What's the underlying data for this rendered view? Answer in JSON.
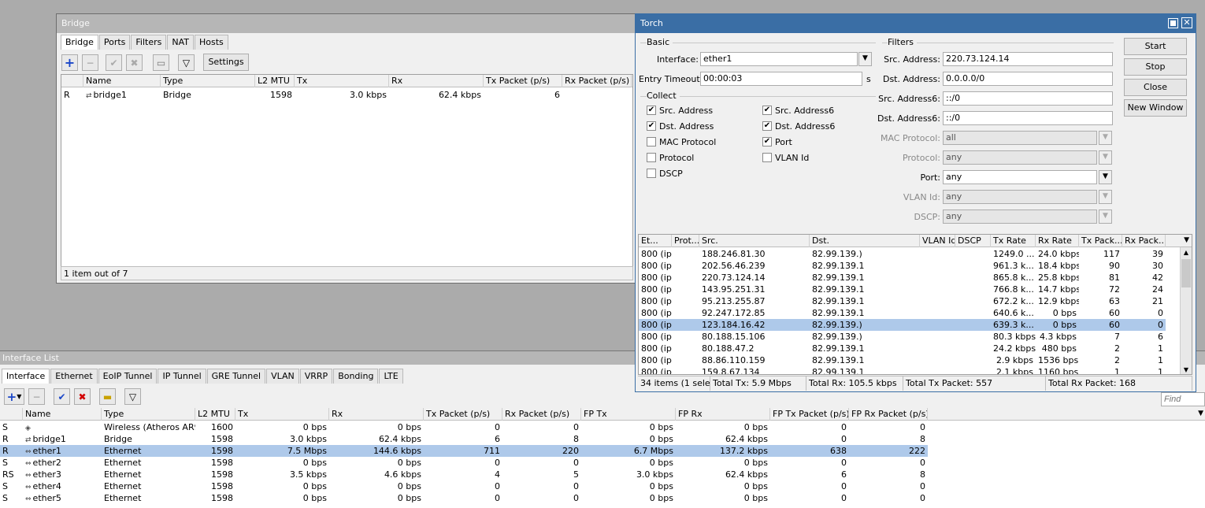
{
  "bridge": {
    "title": "Bridge",
    "tabs": [
      "Bridge",
      "Ports",
      "Filters",
      "NAT",
      "Hosts"
    ],
    "settings_label": "Settings",
    "columns": [
      "",
      "Name",
      "Type",
      "L2 MTU",
      "Tx",
      "Rx",
      "Tx Packet (p/s)",
      "Rx Packet (p/s)"
    ],
    "rows": [
      [
        "R",
        "bridge1",
        "Bridge",
        "1598",
        "3.0 kbps",
        "62.4 kbps",
        "6",
        ""
      ]
    ],
    "status": "1 item out of 7"
  },
  "torch": {
    "title": "Torch",
    "basic_label": "Basic",
    "interface_label": "Interface:",
    "interface_value": "ether1",
    "entry_timeout_label": "Entry Timeout:",
    "entry_timeout_value": "00:00:03",
    "entry_timeout_unit": "s",
    "collect_label": "Collect",
    "collect": [
      {
        "label": "Src. Address",
        "checked": true
      },
      {
        "label": "Dst. Address",
        "checked": true
      },
      {
        "label": "MAC Protocol",
        "checked": false
      },
      {
        "label": "Protocol",
        "checked": false
      },
      {
        "label": "DSCP",
        "checked": false
      },
      {
        "label": "Src. Address6",
        "checked": true
      },
      {
        "label": "Dst. Address6",
        "checked": true
      },
      {
        "label": "Port",
        "checked": true
      },
      {
        "label": "VLAN Id",
        "checked": false
      }
    ],
    "filters_label": "Filters",
    "filters": [
      {
        "label": "Src. Address:",
        "value": "220.73.124.14",
        "disabled": false,
        "dd": false
      },
      {
        "label": "Dst. Address:",
        "value": "0.0.0.0/0",
        "disabled": false,
        "dd": false
      },
      {
        "label": "Src. Address6:",
        "value": "::/0",
        "disabled": false,
        "dd": false
      },
      {
        "label": "Dst. Address6:",
        "value": "::/0",
        "disabled": false,
        "dd": false
      },
      {
        "label": "MAC Protocol:",
        "value": "all",
        "disabled": true,
        "dd": true
      },
      {
        "label": "Protocol:",
        "value": "any",
        "disabled": true,
        "dd": true
      },
      {
        "label": "Port:",
        "value": "any",
        "disabled": false,
        "dd": true
      },
      {
        "label": "VLAN Id:",
        "value": "any",
        "disabled": true,
        "dd": true
      },
      {
        "label": "DSCP:",
        "value": "any",
        "disabled": true,
        "dd": true
      }
    ],
    "buttons": [
      "Start",
      "Stop",
      "Close",
      "New Window"
    ],
    "columns": [
      "Et...",
      "Prot...",
      "Src.",
      "Dst.",
      "VLAN Id",
      "DSCP",
      "Tx Rate",
      "Rx Rate",
      "Tx Pack...",
      "Rx Pack..."
    ],
    "rows": [
      [
        "800 (ip)",
        "",
        "188.246.81.30",
        "82.99.139.)",
        "",
        "",
        "1249.0 ...",
        "24.0 kbps",
        "117",
        "39"
      ],
      [
        "800 (ip)",
        "",
        "202.56.46.239",
        "82.99.139.1",
        "",
        "",
        "961.3 k...",
        "18.4 kbps",
        "90",
        "30"
      ],
      [
        "800 (ip)",
        "",
        "220.73.124.14",
        "82.99.139.1",
        "",
        "",
        "865.8 k...",
        "25.8 kbps",
        "81",
        "42"
      ],
      [
        "800 (ip)",
        "",
        "143.95.251.31",
        "82.99.139.1",
        "",
        "",
        "766.8 k...",
        "14.7 kbps",
        "72",
        "24"
      ],
      [
        "800 (ip)",
        "",
        "95.213.255.87",
        "82.99.139.1",
        "",
        "",
        "672.2 k...",
        "12.9 kbps",
        "63",
        "21"
      ],
      [
        "800 (ip)",
        "",
        "92.247.172.85",
        "82.99.139.1",
        "",
        "",
        "640.6 k...",
        "0 bps",
        "60",
        "0"
      ],
      [
        "800 (ip)",
        "",
        "123.184.16.42",
        "82.99.139.)",
        "",
        "",
        "639.3 k...",
        "0 bps",
        "60",
        "0"
      ],
      [
        "800 (ip)",
        "",
        "80.188.15.106",
        "82.99.139.)",
        "",
        "",
        "80.3 kbps",
        "4.3 kbps",
        "7",
        "6"
      ],
      [
        "800 (ip)",
        "",
        "80.188.47.2",
        "82.99.139.1",
        "",
        "",
        "24.2 kbps",
        "480 bps",
        "2",
        "1"
      ],
      [
        "800 (ip)",
        "",
        "88.86.110.159",
        "82.99.139.1",
        "",
        "",
        "2.9 kbps",
        "1536 bps",
        "2",
        "1"
      ],
      [
        "800 (ip)",
        "",
        "159.8.67.134",
        "82.99.139.1",
        "",
        "",
        "2.1 kbps",
        "1160 bps",
        "1",
        "1"
      ]
    ],
    "selected_row": 6,
    "status": [
      "34 items (1 sele...",
      "Total Tx: 5.9 Mbps",
      "Total Rx: 105.5 kbps",
      "Total Tx Packet: 557",
      "Total Rx Packet: 168"
    ]
  },
  "iflist": {
    "title": "Interface List",
    "tabs": [
      "Interface",
      "Ethernet",
      "EoIP Tunnel",
      "IP Tunnel",
      "GRE Tunnel",
      "VLAN",
      "VRRP",
      "Bonding",
      "LTE"
    ],
    "find_placeholder": "Find",
    "columns": [
      "",
      "Name",
      "Type",
      "L2 MTU",
      "Tx",
      "Rx",
      "Tx Packet (p/s)",
      "Rx Packet (p/s)",
      "FP Tx",
      "FP Rx",
      "FP Tx Packet (p/s)",
      "FP Rx Packet (p/s)"
    ],
    "rows": [
      [
        "S",
        "",
        "Wireless (Atheros AR9...",
        "1600",
        "0 bps",
        "0 bps",
        "0",
        "0",
        "0 bps",
        "0 bps",
        "0",
        "0"
      ],
      [
        "R",
        "bridge1",
        "Bridge",
        "1598",
        "3.0 kbps",
        "62.4 kbps",
        "6",
        "8",
        "0 bps",
        "62.4 kbps",
        "0",
        "8"
      ],
      [
        "R",
        "ether1",
        "Ethernet",
        "1598",
        "7.5 Mbps",
        "144.6 kbps",
        "711",
        "220",
        "6.7 Mbps",
        "137.2 kbps",
        "638",
        "222"
      ],
      [
        "S",
        "ether2",
        "Ethernet",
        "1598",
        "0 bps",
        "0 bps",
        "0",
        "0",
        "0 bps",
        "0 bps",
        "0",
        "0"
      ],
      [
        "RS",
        "ether3",
        "Ethernet",
        "1598",
        "3.5 kbps",
        "4.6 kbps",
        "4",
        "5",
        "3.0 kbps",
        "62.4 kbps",
        "6",
        "8"
      ],
      [
        "S",
        "ether4",
        "Ethernet",
        "1598",
        "0 bps",
        "0 bps",
        "0",
        "0",
        "0 bps",
        "0 bps",
        "0",
        "0"
      ],
      [
        "S",
        "ether5",
        "Ethernet",
        "1598",
        "0 bps",
        "0 bps",
        "0",
        "0",
        "0 bps",
        "0 bps",
        "0",
        "0"
      ]
    ],
    "selected_row": 2
  }
}
